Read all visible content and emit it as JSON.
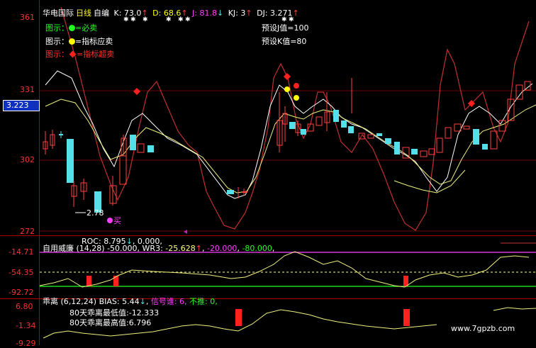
{
  "colors": {
    "bg": "#000000",
    "border": "#b00000",
    "up": "#ff4040",
    "down": "#54e0e8",
    "white_line": "#ffffff",
    "yellow_line": "#f0f080",
    "red_line": "#c03030",
    "magenta": "#ff40ff",
    "green": "#20ff20",
    "yellow": "#ffff00",
    "red": "#ff2020",
    "cyan": "#00e0e0"
  },
  "main_panel": {
    "title": "华电国际",
    "period": "日线",
    "indicator_name": "自编",
    "indicators": [
      {
        "key": "K",
        "value": "73.0",
        "dir": "↑"
      },
      {
        "key": "D",
        "value": "68.6",
        "dir": "↑"
      },
      {
        "key": "J",
        "value": "81.8",
        "dir": "↓"
      },
      {
        "key": "KJ",
        "value": "3",
        "dir": "↑"
      },
      {
        "key": "DJ",
        "value": "3.271",
        "dir": "↑"
      }
    ],
    "y_labels": [
      "361",
      "331",
      "302",
      "272"
    ],
    "current_price": "3.223",
    "legend": [
      {
        "prefix": "图示：",
        "icon": "green-dot",
        "text": "=必卖"
      },
      {
        "prefix": "图示：",
        "icon": "yellow-dot",
        "text": "=指标应卖"
      },
      {
        "prefix": "图示：",
        "icon": "red-diamond",
        "text": "=指标超卖"
      }
    ],
    "preset_j": "预设J值=100",
    "preset_k": "预设K值=80",
    "low_marker": "2.78",
    "buy_label": "买"
  },
  "williams_panel": {
    "roc_label": "ROC",
    "roc_value": "8.795",
    "roc_dir": "↓",
    "roc_extra": "0.000",
    "title": "自用威廉",
    "params": "(14,28)",
    "wr_value": "-50.000",
    "wr3_label": "WR3",
    "wr3_value": "-25.628",
    "wr3_dir": "↑",
    "level1": "-20.000",
    "level2": "-80.000",
    "y_labels": [
      "-14.71",
      "-54.35",
      "-92.72"
    ]
  },
  "bias_panel": {
    "title": "乖离",
    "params": "(6,12,24)",
    "bias_label": "BIAS",
    "bias_value": "5.44",
    "bias_dir": "↓",
    "signal_label": "信号谁",
    "signal_value": "6",
    "no_push_label": "不推",
    "no_push_value": "0",
    "low_text": "80天乖离最低值",
    "low_value": "-12.333",
    "high_text": "80天乖离最高值",
    "high_value": "6.796",
    "y_labels": [
      "6.80",
      "-1.34",
      "-9.29"
    ]
  },
  "watermark": "www.7gpzb.com"
}
